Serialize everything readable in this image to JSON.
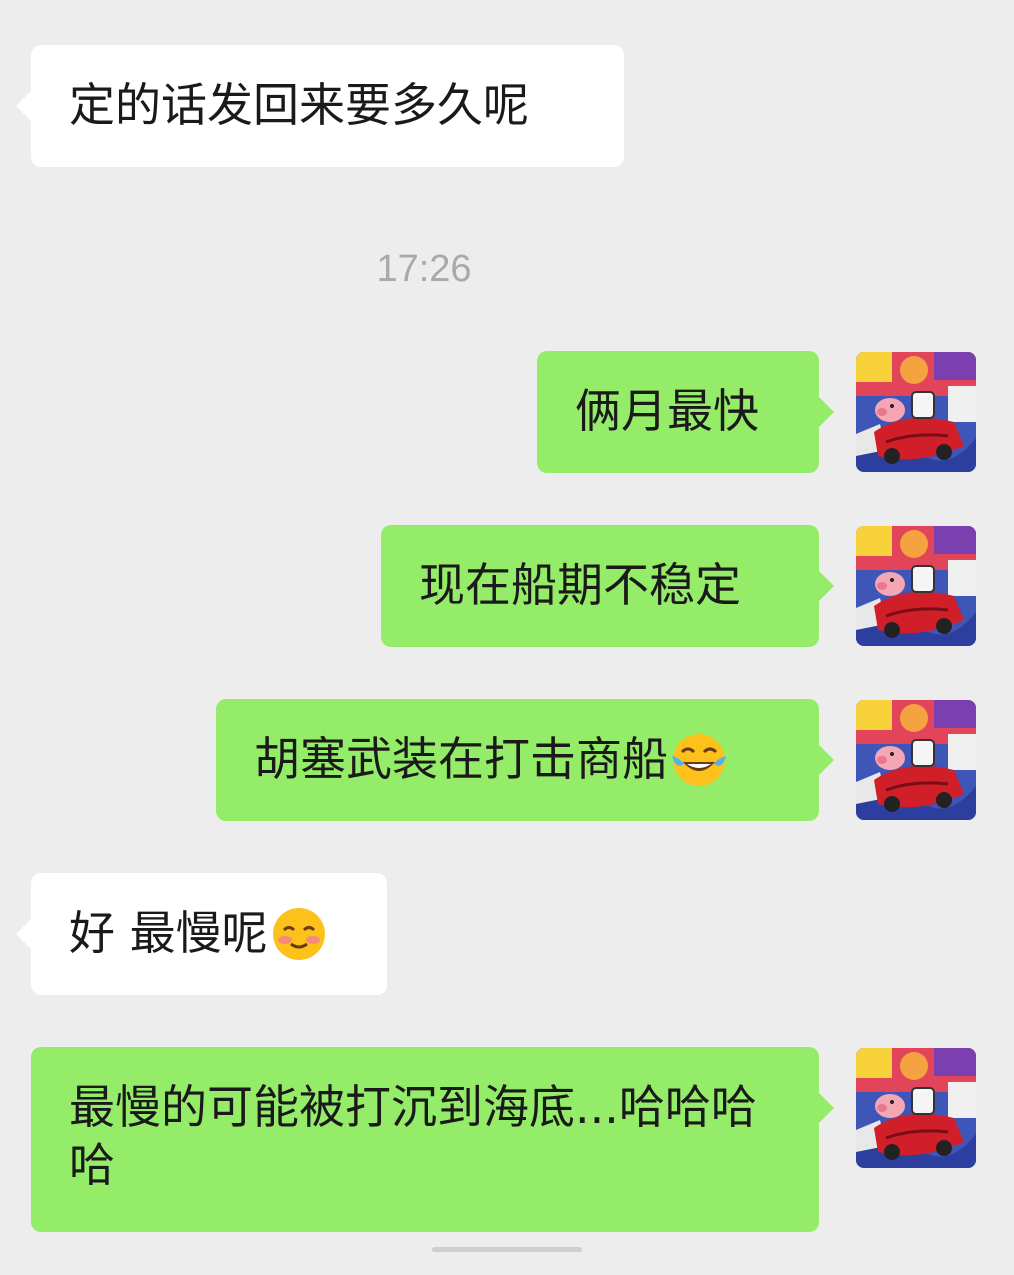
{
  "chat": {
    "timestamp": "17:26",
    "messages": [
      {
        "side": "left",
        "text": "定的话发回来要多久呢"
      },
      {
        "side": "right",
        "text": "俩月最快"
      },
      {
        "side": "right",
        "text": "现在船期不稳定"
      },
      {
        "side": "right",
        "text": "胡塞武装在打击商船",
        "emoji": "face-with-tears-of-joy-emoji"
      },
      {
        "side": "left",
        "text": "好 最慢呢",
        "emoji": "smiling-face-with-smiling-eyes-emoji"
      },
      {
        "side": "right",
        "text": "最慢的可能被打沉到海底...哈哈哈哈"
      }
    ]
  },
  "colors": {
    "background": "#ededed",
    "incoming_bubble": "#ffffff",
    "outgoing_bubble": "#95ec69",
    "timestamp": "#a9a9a9"
  }
}
